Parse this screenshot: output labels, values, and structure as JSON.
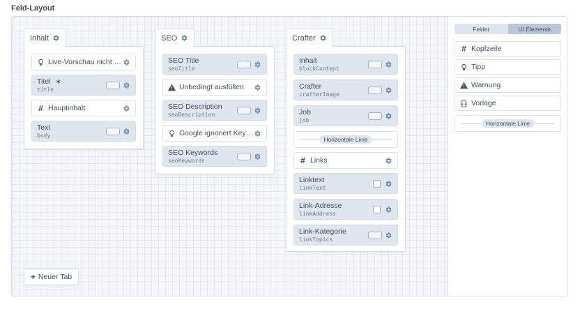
{
  "section_title": "Feld-Layout",
  "colors": {
    "field_bg": "#dfe6ef",
    "canvas_bg": "#f4f6f9",
    "text": "#3f4d5a",
    "active_segment": "#b9c7d8"
  },
  "tabs": [
    {
      "name": "Inhalt",
      "elements": [
        {
          "kind": "tip",
          "icon": "lightbulb-icon",
          "label": "Live-Vorschau nicht …"
        },
        {
          "kind": "field",
          "label": "Titel",
          "required": true,
          "handle": "title",
          "control": "toggle"
        },
        {
          "kind": "heading",
          "icon": "hash-icon",
          "label": "Hauptinhalt"
        },
        {
          "kind": "field",
          "label": "Text",
          "handle": "body",
          "control": "toggle"
        }
      ]
    },
    {
      "name": "SEO",
      "elements": [
        {
          "kind": "field",
          "label": "SEO Title",
          "handle": "seoTitle",
          "control": "toggle"
        },
        {
          "kind": "warning",
          "icon": "warning-icon",
          "label": "Unbedingt ausfüllen"
        },
        {
          "kind": "field",
          "label": "SEO Description",
          "handle": "seoDescription",
          "control": "toggle"
        },
        {
          "kind": "tip",
          "icon": "lightbulb-icon",
          "label": "Google ignoriert Key…"
        },
        {
          "kind": "field",
          "label": "SEO Keywords",
          "handle": "seoKeywords",
          "control": "toggle"
        }
      ]
    },
    {
      "name": "Crafter",
      "elements": [
        {
          "kind": "field",
          "label": "Inhalt",
          "handle": "blockContent",
          "control": "toggle"
        },
        {
          "kind": "field",
          "label": "Crafter",
          "handle": "crafterImage",
          "control": "toggle"
        },
        {
          "kind": "field",
          "label": "Job",
          "handle": "job",
          "control": "toggle"
        },
        {
          "kind": "hr",
          "label": "Horizontale Linie"
        },
        {
          "kind": "heading",
          "icon": "hash-icon",
          "label": "Links"
        },
        {
          "kind": "field",
          "label": "Linktext",
          "handle": "linkText",
          "control": "checkbox"
        },
        {
          "kind": "field",
          "label": "Link-Adresse",
          "handle": "linkAddress",
          "control": "checkbox"
        },
        {
          "kind": "field",
          "label": "Link-Kategorie",
          "handle": "linkTopics",
          "control": "toggle"
        }
      ]
    }
  ],
  "new_tab_label": "Neuer Tab",
  "sidebar": {
    "segments": [
      {
        "label": "Felder",
        "active": false
      },
      {
        "label": "UI Elemente",
        "active": true
      }
    ],
    "items": [
      {
        "icon": "hash-icon",
        "label": "Kopfzeile"
      },
      {
        "icon": "lightbulb-icon",
        "label": "Tipp"
      },
      {
        "icon": "warning-icon",
        "label": "Warnung"
      },
      {
        "icon": "template-icon",
        "label": "Vorlage"
      }
    ],
    "hr_label": "Horizontale Linie"
  }
}
